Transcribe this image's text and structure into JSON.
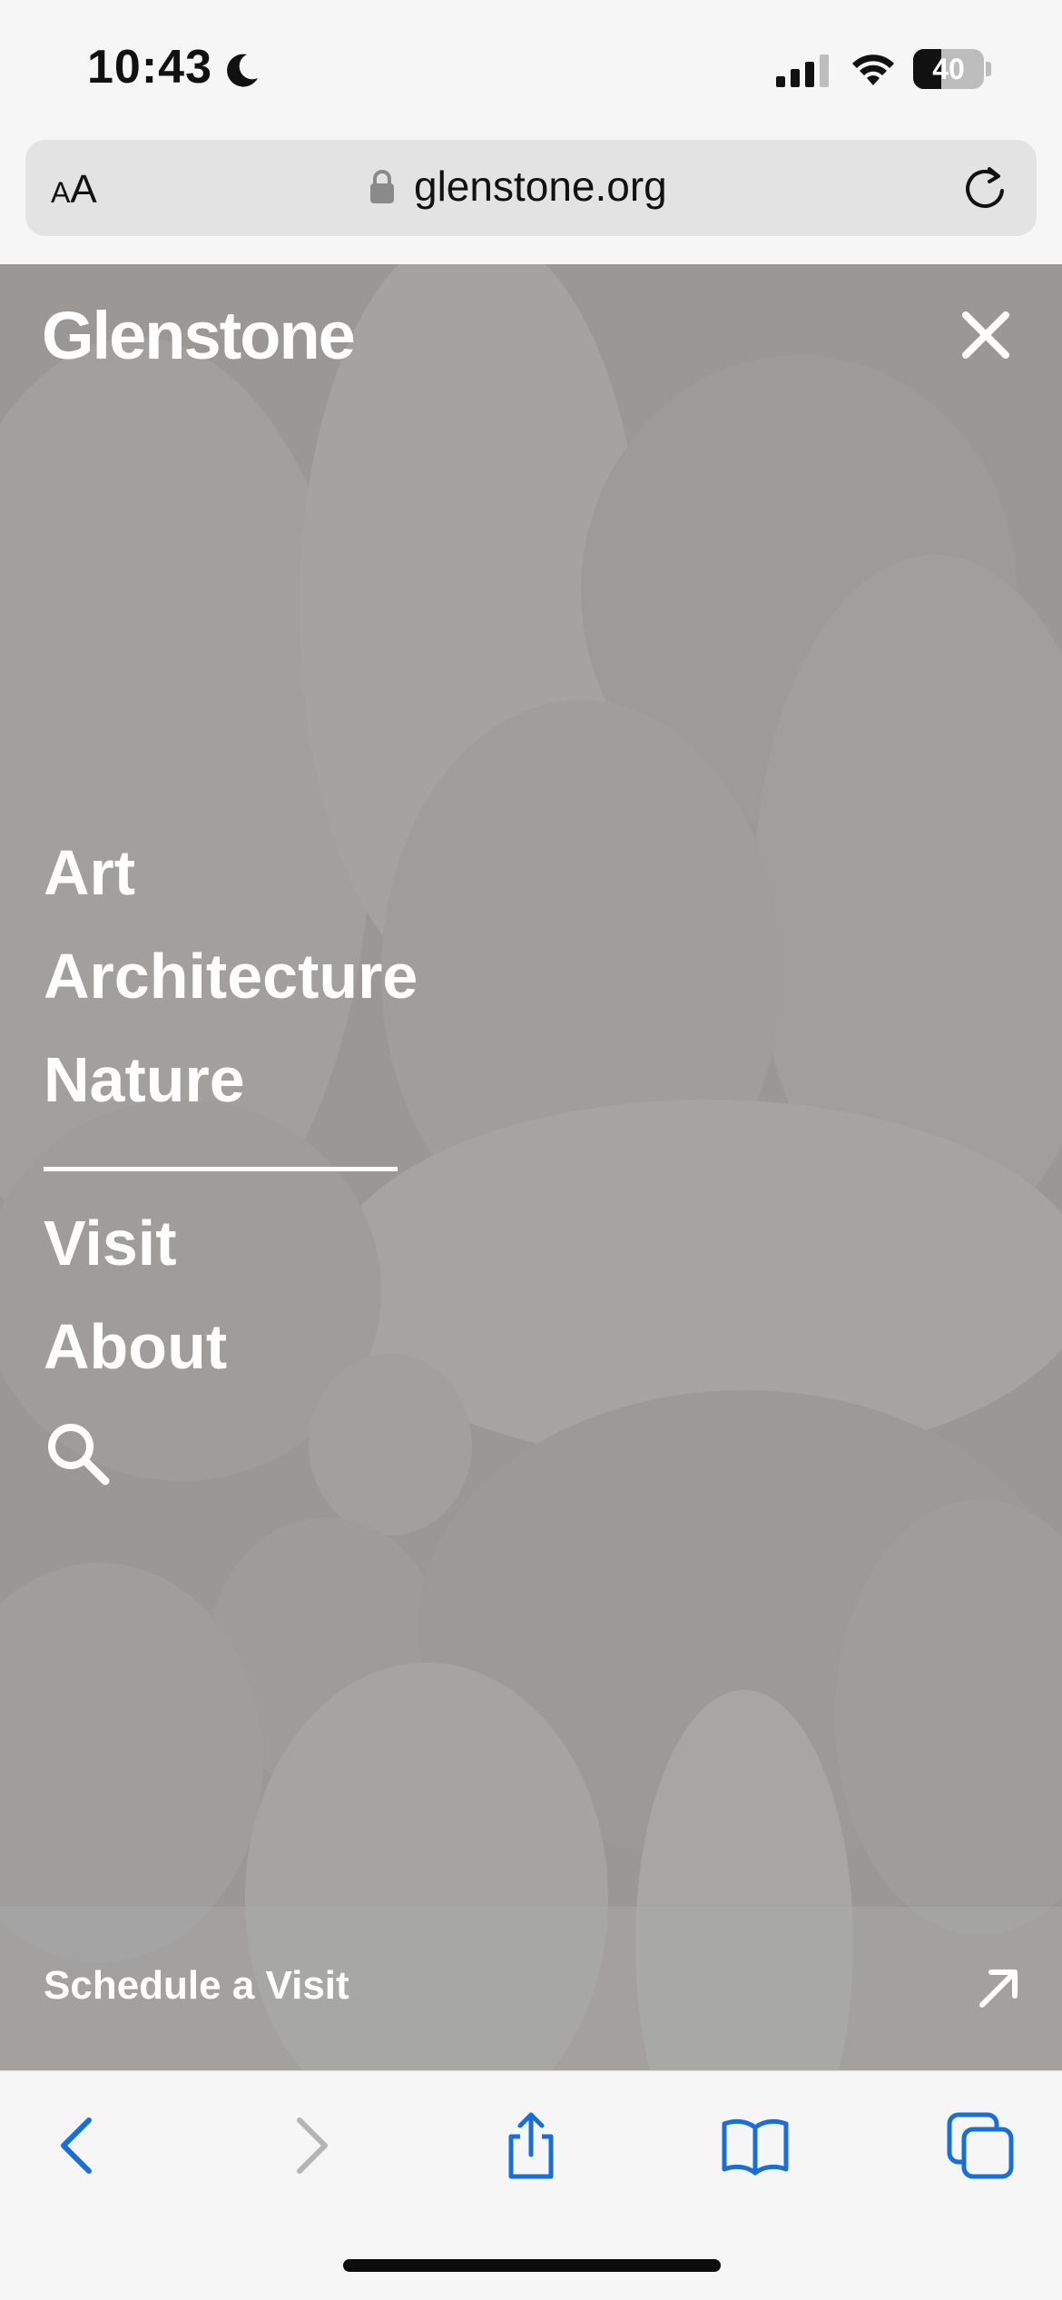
{
  "status_bar": {
    "time": "10:43",
    "focus_icon": "moon-icon",
    "signal_icon": "cellular-signal-icon",
    "wifi_icon": "wifi-icon",
    "battery_level": "40",
    "battery_fraction": 0.4
  },
  "browser": {
    "text_size_label": "AA",
    "url": "glenstone.org",
    "lock_icon": "lock-icon",
    "reload_icon": "reload-icon"
  },
  "site": {
    "logo": "Glenstone",
    "close_icon": "close-icon",
    "nav_primary": [
      "Art",
      "Architecture",
      "Nature"
    ],
    "nav_secondary": [
      "Visit",
      "About"
    ],
    "search_icon": "search-icon",
    "cta_label": "Schedule a Visit",
    "cta_icon": "arrow-up-right-icon"
  },
  "toolbar": {
    "back_icon": "back-icon",
    "forward_icon": "forward-icon",
    "share_icon": "share-icon",
    "bookmarks_icon": "bookmarks-icon",
    "tabs_icon": "tabs-icon",
    "accent": "#1a6fd6",
    "disabled": "#b5b5b5"
  }
}
